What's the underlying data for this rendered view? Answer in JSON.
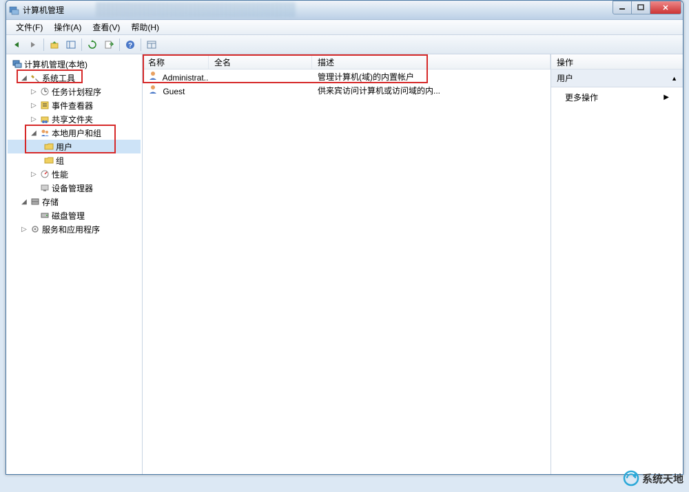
{
  "window": {
    "title": "计算机管理"
  },
  "menubar": [
    {
      "label": "文件(F)"
    },
    {
      "label": "操作(A)"
    },
    {
      "label": "查看(V)"
    },
    {
      "label": "帮助(H)"
    }
  ],
  "tree": {
    "root": "计算机管理(本地)",
    "system_tools": "系统工具",
    "task_scheduler": "任务计划程序",
    "event_viewer": "事件查看器",
    "shared_folders": "共享文件夹",
    "local_users": "本地用户和组",
    "users": "用户",
    "groups": "组",
    "performance": "性能",
    "device_manager": "设备管理器",
    "storage": "存储",
    "disk_management": "磁盘管理",
    "services_apps": "服务和应用程序"
  },
  "list": {
    "columns": {
      "name": "名称",
      "fullname": "全名",
      "description": "描述"
    },
    "rows": [
      {
        "name": "Administrat...",
        "fullname": "",
        "description": "管理计算机(域)的内置帐户"
      },
      {
        "name": "Guest",
        "fullname": "",
        "description": "供来宾访问计算机或访问域的内..."
      }
    ]
  },
  "actions": {
    "header": "操作",
    "group": "用户",
    "more": "更多操作"
  },
  "watermark": "系统天地"
}
